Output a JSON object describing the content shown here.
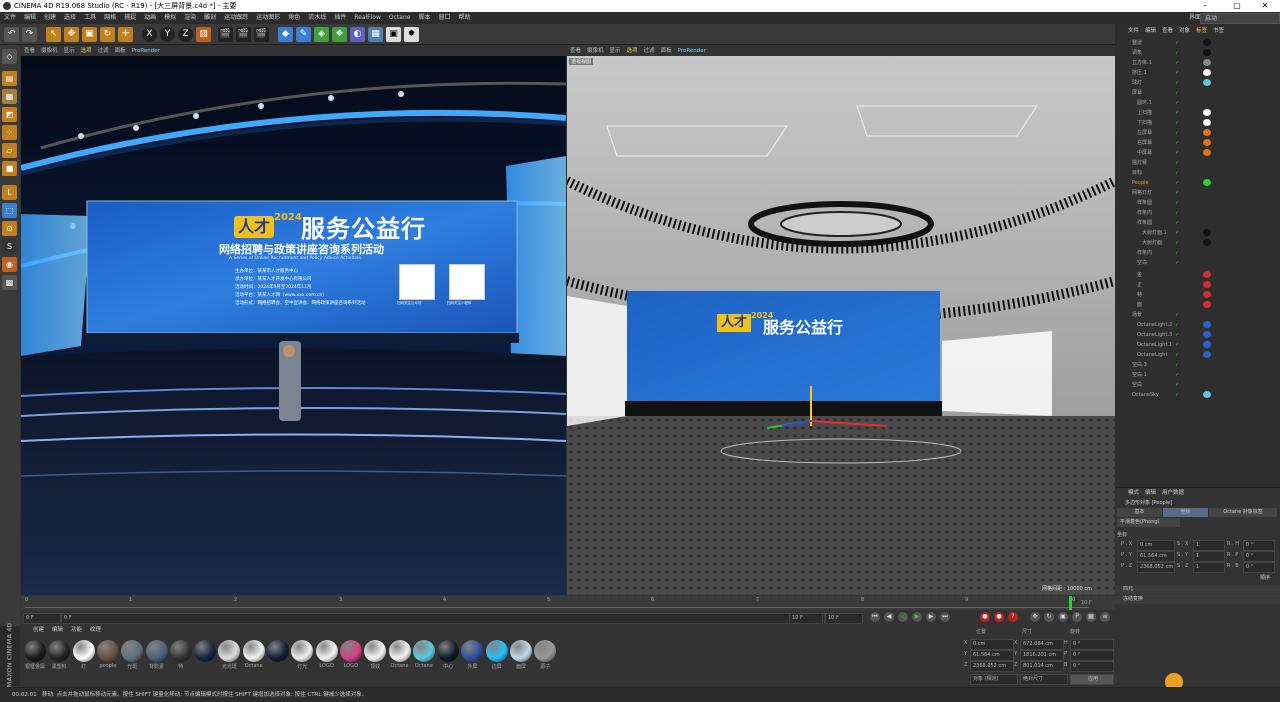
{
  "window": {
    "title": "CINEMA 4D R19.068 Studio (RC - R19) - [大三屏背景.c4d *] - 主要"
  },
  "menu": [
    "文件",
    "编辑",
    "创建",
    "选择",
    "工具",
    "网格",
    "捕捉",
    "动画",
    "模拟",
    "渲染",
    "雕刻",
    "运动跟踪",
    "运动图形",
    "角色",
    "流水线",
    "插件",
    "RealFlow",
    "Octane",
    "脚本",
    "窗口",
    "帮助"
  ],
  "layout": {
    "label": "界面:",
    "value": "启动"
  },
  "toolbar": {
    "axes": [
      "X",
      "Y",
      "Z"
    ]
  },
  "left_viewport": {
    "menu": [
      "查看",
      "摄像机",
      "显示",
      "选项",
      "过滤",
      "面板",
      "ProRender"
    ],
    "highlight": "选项",
    "screen": {
      "logo_text": "人才",
      "year": "2024",
      "title": "服务公益行",
      "subtitle": "网络招聘与政策讲座咨询系列活动",
      "english": "A Series of Online Recruitment and Policy Advice Activities",
      "lines": [
        "主办单位：某某市人才服务中心",
        "承办单位：某某人才开发中心有限公司",
        "活动时间：2024年9月至2024年11月",
        "活动平台：某某人才网（www.xxx.com.cn）",
        "活动形式：网络招聘会、空中宣讲会、网络政策讲座咨询系列活动"
      ],
      "qr1": "扫码关注公众号",
      "qr2": "扫码关注小程序"
    }
  },
  "right_viewport": {
    "menu": [
      "查看",
      "摄像机",
      "显示",
      "选项",
      "过滤",
      "面板",
      "ProRender"
    ],
    "highlight": "选项",
    "label": "透视视图",
    "grid_text": "网格间距 : 10000 cm",
    "screen_logo": "人才",
    "screen_year": "2024",
    "screen_title": "服务公益行"
  },
  "object_manager": {
    "tabs": [
      "文件",
      "编辑",
      "查看",
      "对象",
      "标签",
      "书签"
    ],
    "objects": [
      "整道",
      "调条",
      "立方体.1",
      "挤压.1",
      "球灯",
      "屏幕",
      "圆环.1",
      "上扫描",
      "下扫描",
      "左屏幕",
      "右屏幕",
      "中屏幕",
      "摇灯臂",
      "目标",
      "People",
      "网格灯灯",
      "样条圆",
      "样条内",
      "样条圆",
      "大射灯面.1",
      "大射灯面",
      "样条内",
      "空白",
      "金",
      "正",
      "特",
      "面",
      "场景",
      "OctaneLight.2",
      "OctaneLight.3",
      "OctaneLight.1",
      "OctaneLight",
      "空白.3",
      "空白.1",
      "空白",
      "OctaneSky"
    ]
  },
  "attributes": {
    "tabs": [
      "模式",
      "编辑",
      "用户数据"
    ],
    "object_label": "多边形对象 [People]",
    "subtabs": [
      "基本",
      "坐标",
      "Octane 对象标签"
    ],
    "active_subtab": "坐标",
    "phong": "平滑着色(Phong)",
    "section": "坐标",
    "rows": [
      {
        "p": "P . X",
        "pv": "0 cm",
        "s": "S . X",
        "sv": "1",
        "r": "R . H",
        "rv": "0 °"
      },
      {
        "p": "P . Y",
        "pv": "61.564 cm",
        "s": "S . Y",
        "sv": "1",
        "r": "R . P",
        "rv": "0 °"
      },
      {
        "p": "P . Z",
        "pv": "2368.052 cm",
        "s": "S . Z",
        "sv": "1",
        "r": "R . B",
        "rv": "0 °"
      }
    ],
    "order": "顺序",
    "sections": [
      "四元",
      "冻结变换"
    ]
  },
  "timeline": {
    "ticks": [
      "0",
      "1",
      "2",
      "3",
      "4",
      "5",
      "6",
      "7",
      "8",
      "9",
      "10"
    ],
    "start": "0 F",
    "start2": "0 F",
    "end": "10 F",
    "end2": "10 F",
    "current": "10 F"
  },
  "materials": {
    "tabs": [
      "创建",
      "编辑",
      "功能",
      "纹理"
    ],
    "items": [
      {
        "name": "银框金属",
        "color": "#1a1a1a"
      },
      {
        "name": "黑塑料",
        "color": "#222"
      },
      {
        "name": "灯",
        "color": "#fff"
      },
      {
        "name": "people",
        "color": "#6a5040"
      },
      {
        "name": "光斑",
        "color": "#607080"
      },
      {
        "name": "背影素",
        "color": "#50607a"
      },
      {
        "name": "特",
        "color": "#333"
      },
      {
        "name": "",
        "color": "#1a2440"
      },
      {
        "name": "光光斑",
        "color": "#ddd"
      },
      {
        "name": "Octane",
        "color": "#f0f0f0"
      },
      {
        "name": "",
        "color": "#151e38"
      },
      {
        "name": "灯光",
        "color": "#eee"
      },
      {
        "name": "LOGO",
        "color": "#f4f4f4"
      },
      {
        "name": "LOGO",
        "color": "#d04080"
      },
      {
        "name": "顶效",
        "color": "#f6f6f6"
      },
      {
        "name": "Octane",
        "color": "#f4f4f4"
      },
      {
        "name": "Octane",
        "color": "#5cc8e0"
      },
      {
        "name": "中心",
        "color": "#101828"
      },
      {
        "name": "外屏",
        "color": "#3050a0"
      },
      {
        "name": "边屏",
        "color": "#20c0ff"
      },
      {
        "name": "面屏",
        "color": "#c0d8e8"
      },
      {
        "name": "源子",
        "color": "#999"
      }
    ]
  },
  "coords": {
    "headers": [
      "位置",
      "尺寸",
      "旋转"
    ],
    "rows": [
      {
        "a": "X",
        "av": "0 cm",
        "b": "X",
        "bv": "672.084 cm",
        "c": "H",
        "cv": "0 °"
      },
      {
        "a": "Y",
        "av": "61.564 cm",
        "b": "Y",
        "bv": "1816.201 cm",
        "c": "P",
        "cv": "0 °"
      },
      {
        "a": "Z",
        "av": "2368.052 cm",
        "b": "Z",
        "bv": "801.014 cm",
        "c": "B",
        "cv": "0 °"
      }
    ],
    "mode1": "对象 (相对)",
    "mode2": "绝对尺寸",
    "apply": "应用"
  },
  "status": {
    "time": "00:02:01",
    "text": "移动: 点击并拖动鼠标移动元素。按住 SHIFT 键量化移动; 节点编辑模式时按住 SHIFT 键增加选择对象; 按住 CTRL 键减少选择对象。"
  },
  "brand": {
    "vertical": "MAXON CINEMA 4D"
  },
  "colors": {
    "accent_blue": "#1f6fd0",
    "accent_yellow": "#e8c95a",
    "screen_blue": "#1d5fbf"
  }
}
